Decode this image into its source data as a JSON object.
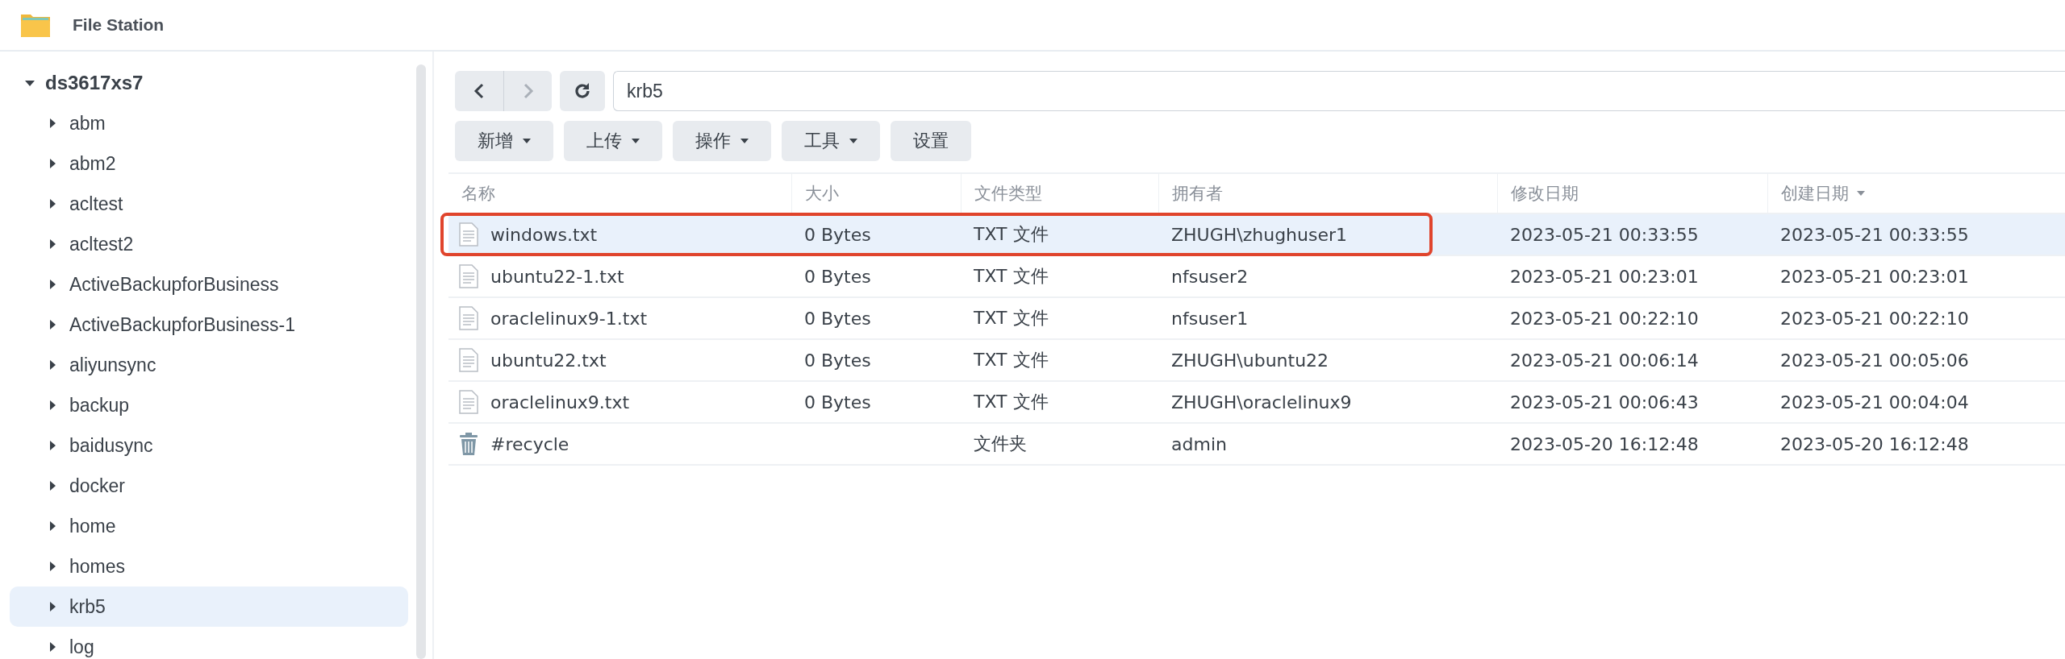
{
  "window": {
    "title": "File Station"
  },
  "sidebar": {
    "tree": [
      {
        "label": "ds3617xs7",
        "expanded": true,
        "selected": false,
        "children": [
          {
            "label": "abm",
            "expanded": false,
            "selected": false
          },
          {
            "label": "abm2",
            "expanded": false,
            "selected": false
          },
          {
            "label": "acltest",
            "expanded": false,
            "selected": false
          },
          {
            "label": "acltest2",
            "expanded": false,
            "selected": false
          },
          {
            "label": "ActiveBackupforBusiness",
            "expanded": false,
            "selected": false
          },
          {
            "label": "ActiveBackupforBusiness-1",
            "expanded": false,
            "selected": false
          },
          {
            "label": "aliyunsync",
            "expanded": false,
            "selected": false
          },
          {
            "label": "backup",
            "expanded": false,
            "selected": false
          },
          {
            "label": "baidusync",
            "expanded": false,
            "selected": false
          },
          {
            "label": "docker",
            "expanded": false,
            "selected": false
          },
          {
            "label": "home",
            "expanded": false,
            "selected": false
          },
          {
            "label": "homes",
            "expanded": false,
            "selected": false
          },
          {
            "label": "krb5",
            "expanded": false,
            "selected": true
          },
          {
            "label": "log",
            "expanded": false,
            "selected": false
          }
        ]
      }
    ]
  },
  "toolbar": {
    "back": {
      "disabled": false
    },
    "forward": {
      "disabled": true
    },
    "path": "krb5",
    "buttons": [
      {
        "label": "新增",
        "dropdown": true
      },
      {
        "label": "上传",
        "dropdown": true
      },
      {
        "label": "操作",
        "dropdown": true
      },
      {
        "label": "工具",
        "dropdown": true
      },
      {
        "label": "设置",
        "dropdown": false
      }
    ]
  },
  "table": {
    "columns": [
      {
        "label": "名称",
        "sorted": false
      },
      {
        "label": "大小",
        "sorted": false
      },
      {
        "label": "文件类型",
        "sorted": false
      },
      {
        "label": "拥有者",
        "sorted": false
      },
      {
        "label": "修改日期",
        "sorted": false
      },
      {
        "label": "创建日期",
        "sorted": true
      }
    ],
    "rows": [
      {
        "kind": "file",
        "selected": true,
        "outlined": true,
        "cells": [
          "windows.txt",
          "0 Bytes",
          "TXT 文件",
          "ZHUGH\\zhughuser1",
          "2023-05-21 00:33:55",
          "2023-05-21 00:33:55"
        ]
      },
      {
        "kind": "file",
        "selected": false,
        "outlined": false,
        "cells": [
          "ubuntu22-1.txt",
          "0 Bytes",
          "TXT 文件",
          "nfsuser2",
          "2023-05-21 00:23:01",
          "2023-05-21 00:23:01"
        ]
      },
      {
        "kind": "file",
        "selected": false,
        "outlined": false,
        "cells": [
          "oraclelinux9-1.txt",
          "0 Bytes",
          "TXT 文件",
          "nfsuser1",
          "2023-05-21 00:22:10",
          "2023-05-21 00:22:10"
        ]
      },
      {
        "kind": "file",
        "selected": false,
        "outlined": false,
        "cells": [
          "ubuntu22.txt",
          "0 Bytes",
          "TXT 文件",
          "ZHUGH\\ubuntu22",
          "2023-05-21 00:06:14",
          "2023-05-21 00:05:06"
        ]
      },
      {
        "kind": "file",
        "selected": false,
        "outlined": false,
        "cells": [
          "oraclelinux9.txt",
          "0 Bytes",
          "TXT 文件",
          "ZHUGH\\oraclelinux9",
          "2023-05-21 00:06:43",
          "2023-05-21 00:04:04"
        ]
      },
      {
        "kind": "recycle",
        "selected": false,
        "outlined": false,
        "cells": [
          "#recycle",
          "",
          "文件夹",
          "admin",
          "2023-05-20 16:12:48",
          "2023-05-20 16:12:48"
        ]
      }
    ]
  }
}
